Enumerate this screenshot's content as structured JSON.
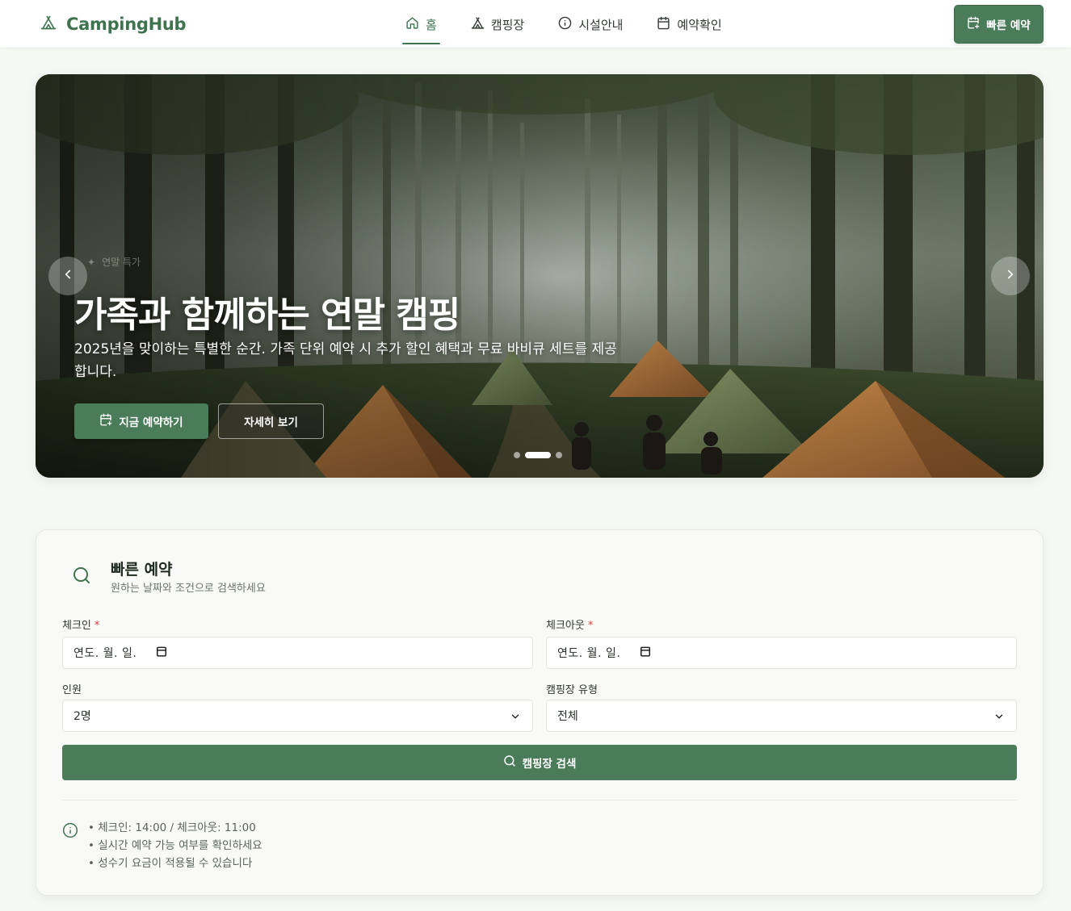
{
  "header": {
    "logo_text": "CampingHub",
    "nav": [
      {
        "label": "홈",
        "icon": "home-icon",
        "active": true
      },
      {
        "label": "캠핑장",
        "icon": "tent-icon",
        "active": false
      },
      {
        "label": "시설안내",
        "icon": "info-icon",
        "active": false
      },
      {
        "label": "예약확인",
        "icon": "calendar-icon",
        "active": false
      }
    ],
    "quick_button_label": "빠른 예약"
  },
  "hero": {
    "badge": "연말 특가",
    "title": "가족과 함께하는 연말 캠핑",
    "subtitle": "2025년을 맞이하는 특별한 순간. 가족 단위 예약 시 추가 할인 혜택과 무료 바비큐 세트를 제공합니다.",
    "primary_button": "지금 예약하기",
    "secondary_button": "자세히 보기",
    "slides_total": 3,
    "active_slide": 2
  },
  "booking": {
    "title": "빠른 예약",
    "description": "원하는 날짜와 조건으로 검색하세요",
    "checkin_label": "체크인",
    "checkout_label": "체크아웃",
    "required_mark": "*",
    "date_placeholder": "연도. 월. 일.",
    "guests_label": "인원",
    "guests_value": "2명",
    "type_label": "캠핑장 유형",
    "type_value": "전체",
    "search_button": "캠핑장 검색",
    "info": [
      "체크인: 14:00 / 체크아웃: 11:00",
      "실시간 예약 가능 여부를 확인하세요",
      "성수기 요금이 적용될 수 있습니다"
    ]
  },
  "colors": {
    "brand": "#4a7c59",
    "brand_text": "#3f7350",
    "required": "#d93c3c"
  }
}
